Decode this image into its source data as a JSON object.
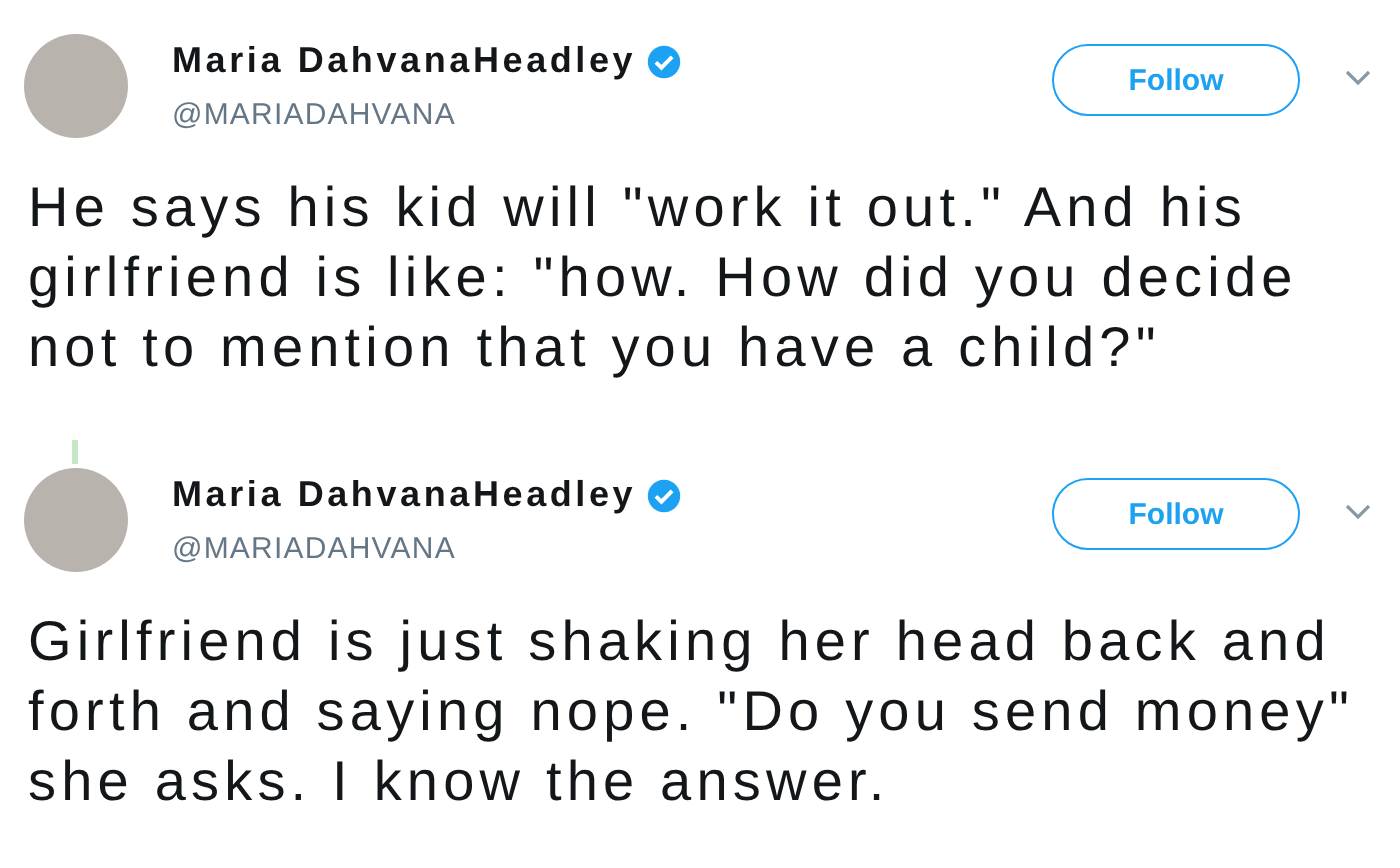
{
  "tweets": [
    {
      "name": "Maria DahvanaHeadley",
      "verified": true,
      "handle": "@MARIADAHVANA",
      "follow_label": "Follow",
      "text": "He says his kid will \"work it out.\" And his girlfriend is like: \"how. How did you decide not to mention that you have a child?\"",
      "thread_line_above": false
    },
    {
      "name": "Maria DahvanaHeadley",
      "verified": true,
      "handle": "@MARIADAHVANA",
      "follow_label": "Follow",
      "text": "Girlfriend is just shaking her head back and forth and saying nope. \"Do you send money\" she asks. I know the answer.",
      "thread_line_above": true
    }
  ]
}
